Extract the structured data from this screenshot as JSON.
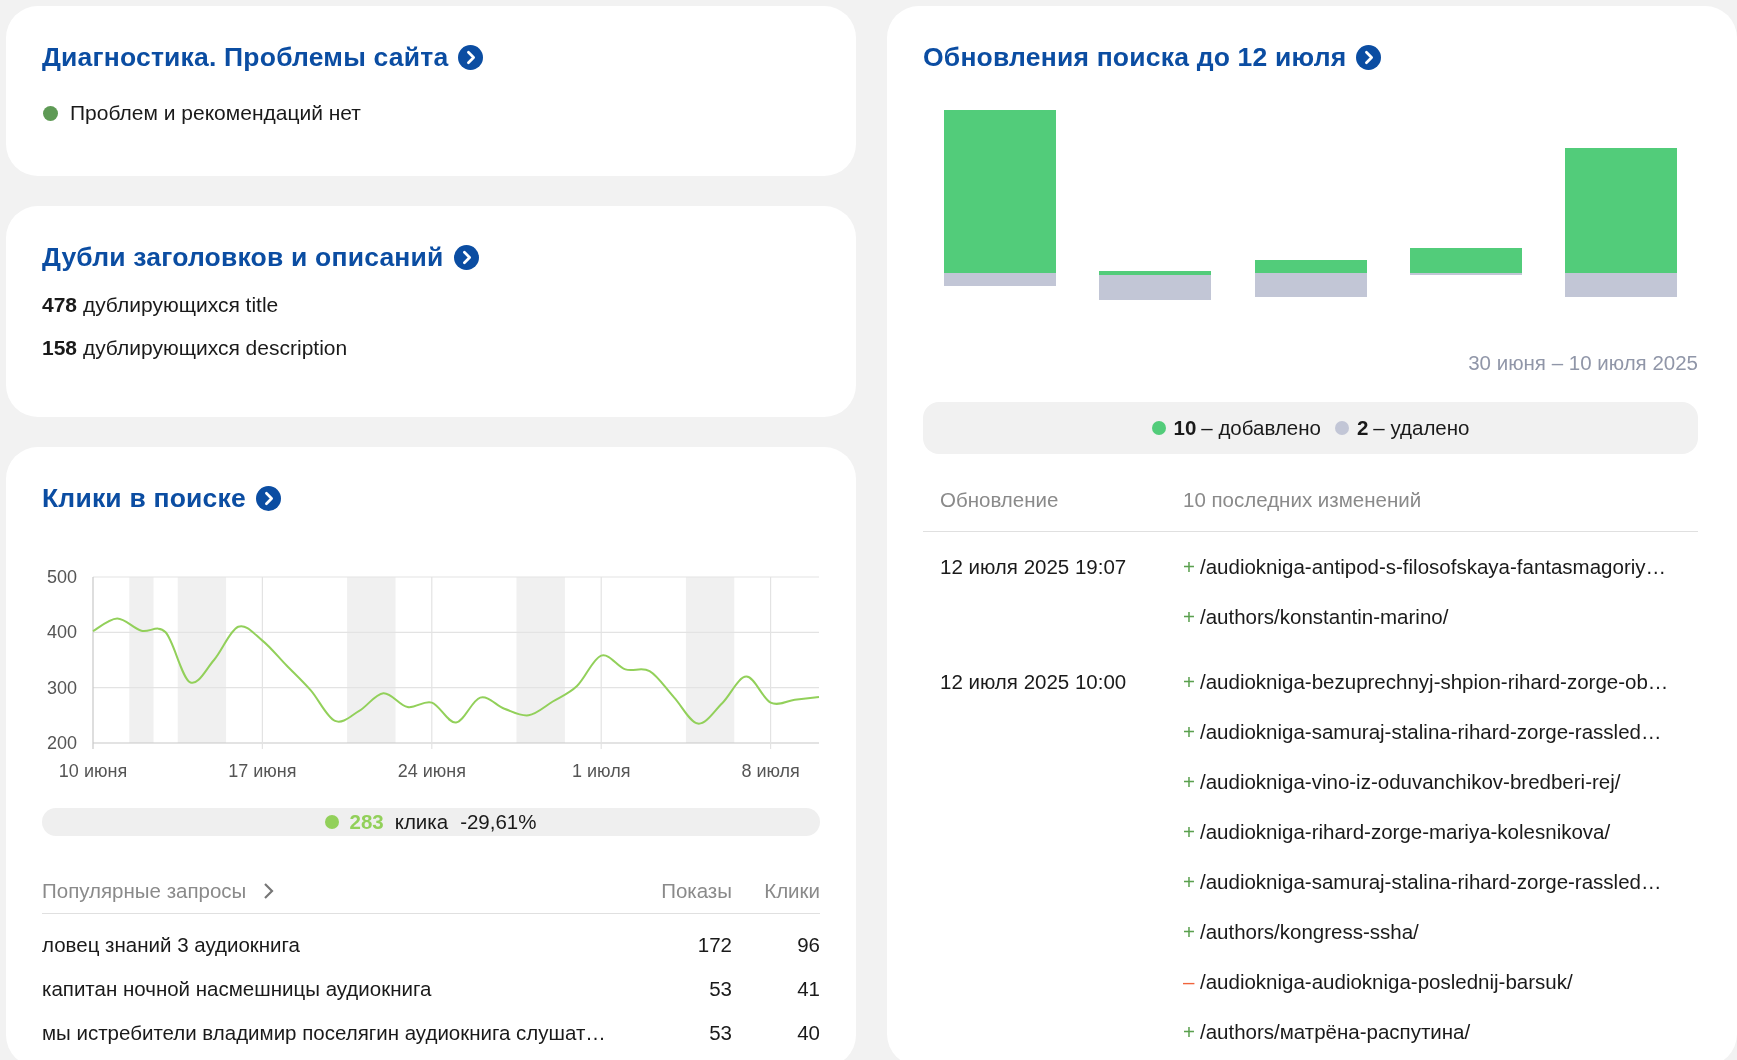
{
  "diagnostics": {
    "title": "Диагностика. Проблемы сайта",
    "status": {
      "text": "Проблем и рекомендаций нет",
      "color": "#5e9a55"
    }
  },
  "duplicates": {
    "title": "Дубли заголовков и описаний",
    "lines": [
      "**478** дублирующихся title",
      "**158** дублирующихся description"
    ]
  },
  "clicks": {
    "title": "Клики в поиске",
    "chart_data": {
      "type": "line",
      "categories": [
        "10 июня",
        null,
        null,
        null,
        null,
        null,
        null,
        "17 июня",
        null,
        null,
        null,
        null,
        null,
        null,
        "24 июня",
        null,
        null,
        null,
        null,
        null,
        null,
        "1 июля",
        null,
        null,
        null,
        null,
        null,
        null,
        "8 июля",
        null,
        null
      ],
      "series": [
        {
          "color": "#92d05a",
          "values": [
            402,
            425,
            403,
            400,
            310,
            350,
            410,
            385,
            340,
            295,
            240,
            258,
            290,
            265,
            273,
            237,
            282,
            262,
            250,
            275,
            303,
            358,
            333,
            330,
            283,
            235,
            272,
            320,
            273,
            278,
            283
          ]
        }
      ],
      "ylim": [
        200,
        500
      ],
      "yticks": [
        200,
        300,
        400,
        500
      ],
      "grid": true
    },
    "summary": {
      "value": "283",
      "label": "клика",
      "change": "-29,61%"
    },
    "queries": {
      "columns": [
        "Популярные запросы",
        "Показы",
        "Клики"
      ],
      "rows": [
        [
          "ловец знаний 3 аудиокнига",
          "172",
          "96"
        ],
        [
          "капитан ночной насмешницы аудиокнига",
          "53",
          "41"
        ],
        [
          "мы истребители владимир поселягин аудиокнига слушат…",
          "53",
          "40"
        ]
      ]
    }
  },
  "updates": {
    "title": "Обновления поиска до 12 июля",
    "period": "30 июня – 10 июля 2025",
    "legend": [
      {
        "count": "10",
        "label": "– добавлено",
        "color": "#52cc7a"
      },
      {
        "count": "2",
        "label": "– удалено",
        "color": "#c2c6d6"
      }
    ],
    "columns": [
      "Обновление",
      "10 последних изменений"
    ],
    "groups": [
      {
        "date": "12 июля 2025 19:07",
        "changes": [
          {
            "kind": "added",
            "sign": "+",
            "path": "/audiokniga-antipod-s-filosofskaya-fantasmagoriy…"
          },
          {
            "kind": "added",
            "sign": "+",
            "path": "/authors/konstantin-marino/"
          }
        ]
      },
      {
        "date": "12 июля 2025 10:00",
        "changes": [
          {
            "kind": "added",
            "sign": "+",
            "path": "/audiokniga-bezuprechnyj-shpion-rihard-zorge-ob…"
          },
          {
            "kind": "added",
            "sign": "+",
            "path": "/audiokniga-samuraj-stalina-rihard-zorge-rassled…"
          },
          {
            "kind": "added",
            "sign": "+",
            "path": "/audiokniga-vino-iz-oduvanchikov-bredberi-rej/"
          },
          {
            "kind": "added",
            "sign": "+",
            "path": "/audiokniga-rihard-zorge-mariya-kolesnikova/"
          },
          {
            "kind": "added",
            "sign": "+",
            "path": "/audiokniga-samuraj-stalina-rihard-zorge-rassled…"
          },
          {
            "kind": "added",
            "sign": "+",
            "path": "/authors/kongress-ssha/"
          },
          {
            "kind": "removed",
            "sign": "–",
            "path": "/audiokniga-audiokniga-poslednij-barsuk/"
          },
          {
            "kind": "added",
            "sign": "+",
            "path": "/authors/матрёна-распутина/"
          }
        ]
      }
    ]
  }
}
